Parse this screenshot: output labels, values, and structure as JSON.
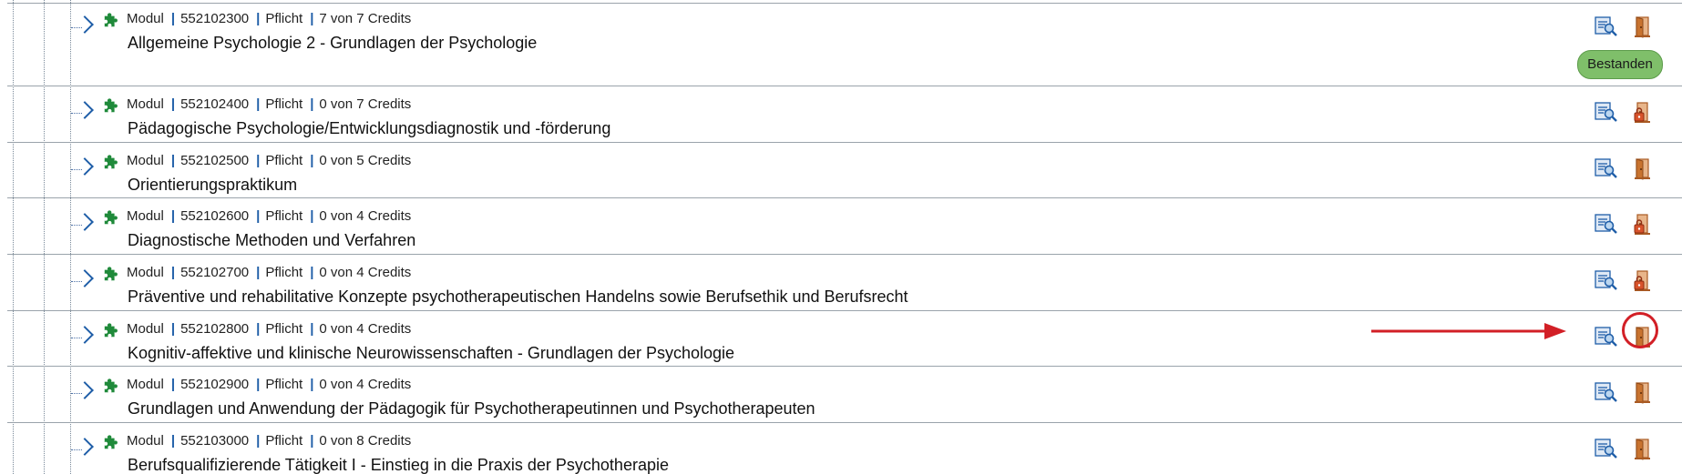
{
  "modules": [
    {
      "type": "Modul",
      "number": "552102300",
      "kind": "Pflicht",
      "credits": "7 von 7 Credits",
      "title": "Allgemeine Psychologie 2 - Grundlagen der Psychologie",
      "status": "Bestanden",
      "door_icon": "door-icon"
    },
    {
      "type": "Modul",
      "number": "552102400",
      "kind": "Pflicht",
      "credits": "0 von 7 Credits",
      "title": "Pädagogische Psychologie/Entwicklungsdiagnostik und -förderung",
      "status": "",
      "door_icon": "door-locked-icon"
    },
    {
      "type": "Modul",
      "number": "552102500",
      "kind": "Pflicht",
      "credits": "0 von 5 Credits",
      "title": "Orientierungspraktikum",
      "status": "",
      "door_icon": "door-icon"
    },
    {
      "type": "Modul",
      "number": "552102600",
      "kind": "Pflicht",
      "credits": "0 von 4 Credits",
      "title": "Diagnostische Methoden und Verfahren",
      "status": "",
      "door_icon": "door-locked-icon"
    },
    {
      "type": "Modul",
      "number": "552102700",
      "kind": "Pflicht",
      "credits": "0 von 4 Credits",
      "title": "Präventive und rehabilitative Konzepte psychotherapeutischen Handelns sowie Berufsethik und Berufsrecht",
      "status": "",
      "door_icon": "door-locked-icon"
    },
    {
      "type": "Modul",
      "number": "552102800",
      "kind": "Pflicht",
      "credits": "0 von 4 Credits",
      "title": "Kognitiv-affektive und klinische Neurowissenschaften - Grundlagen der Psychologie",
      "status": "",
      "door_icon": "door-icon"
    },
    {
      "type": "Modul",
      "number": "552102900",
      "kind": "Pflicht",
      "credits": "0 von 4 Credits",
      "title": "Grundlagen und Anwendung der Pädagogik für Psychotherapeutinnen und Psychotherapeuten",
      "status": "",
      "door_icon": "door-icon"
    },
    {
      "type": "Modul",
      "number": "552103000",
      "kind": "Pflicht",
      "credits": "0 von 8 Credits",
      "title": "Berufsqualifizierende Tätigkeit I - Einstieg in die Praxis der Psychotherapie",
      "status": "",
      "door_icon": "door-icon"
    }
  ],
  "colors": {
    "puzzle": "#1f8a3a",
    "link_blue": "#1f5ea8",
    "door_orange": "#c8732f",
    "badge_green": "#7fbf6a",
    "annotation_red": "#d21f26"
  },
  "annotation": {
    "highlighted_row_index": 5,
    "highlight": "door-icon"
  }
}
